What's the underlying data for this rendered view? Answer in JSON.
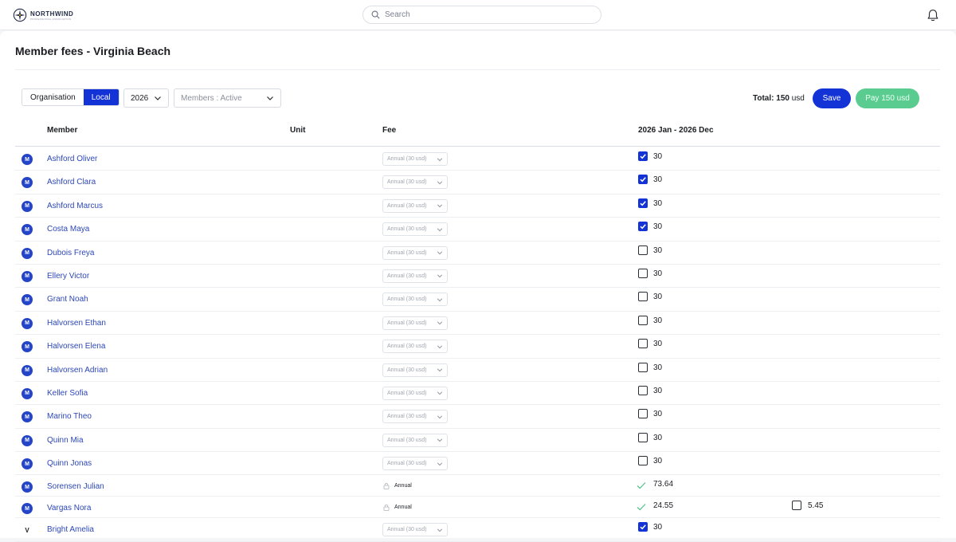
{
  "header": {
    "logo_name": "NORTHWIND",
    "logo_sub": "PROFESSIONAL ASSOCIATION",
    "search_placeholder": "Search"
  },
  "page": {
    "title": "Member fees - Virginia Beach"
  },
  "toolbar": {
    "scope_tabs": [
      "Organisation",
      "Local"
    ],
    "active_scope": "Local",
    "year": "2026",
    "members_filter": "Members : Active",
    "total_label": "Total:",
    "total_value": "150",
    "total_unit": "usd",
    "save_label": "Save",
    "pay_label": "Pay 150 usd"
  },
  "table": {
    "columns": [
      "Member",
      "Unit",
      "Fee",
      "2026 Jan - 2026 Dec"
    ],
    "rows": [
      {
        "avatar": "M",
        "name": "Ashford Oliver",
        "fee": "Annual (30 usd)",
        "fee_type": "select",
        "paid": true,
        "amount": "30"
      },
      {
        "avatar": "M",
        "name": "Ashford Clara",
        "fee": "Annual (30 usd)",
        "fee_type": "select",
        "paid": true,
        "amount": "30"
      },
      {
        "avatar": "M",
        "name": "Ashford Marcus",
        "fee": "Annual (30 usd)",
        "fee_type": "select",
        "paid": true,
        "amount": "30"
      },
      {
        "avatar": "M",
        "name": "Costa Maya",
        "fee": "Annual (30 usd)",
        "fee_type": "select",
        "paid": true,
        "amount": "30"
      },
      {
        "avatar": "M",
        "name": "Dubois Freya",
        "fee": "Annual (30 usd)",
        "fee_type": "select",
        "paid": false,
        "amount": "30"
      },
      {
        "avatar": "M",
        "name": "Ellery Victor",
        "fee": "Annual (30 usd)",
        "fee_type": "select",
        "paid": false,
        "amount": "30"
      },
      {
        "avatar": "M",
        "name": "Grant Noah",
        "fee": "Annual (30 usd)",
        "fee_type": "select",
        "paid": false,
        "amount": "30"
      },
      {
        "avatar": "M",
        "name": "Halvorsen Ethan",
        "fee": "Annual (30 usd)",
        "fee_type": "select",
        "paid": false,
        "amount": "30"
      },
      {
        "avatar": "M",
        "name": "Halvorsen Elena",
        "fee": "Annual (30 usd)",
        "fee_type": "select",
        "paid": false,
        "amount": "30"
      },
      {
        "avatar": "M",
        "name": "Halvorsen Adrian",
        "fee": "Annual (30 usd)",
        "fee_type": "select",
        "paid": false,
        "amount": "30"
      },
      {
        "avatar": "M",
        "name": "Keller Sofia",
        "fee": "Annual (30 usd)",
        "fee_type": "select",
        "paid": false,
        "amount": "30"
      },
      {
        "avatar": "M",
        "name": "Marino Theo",
        "fee": "Annual (30 usd)",
        "fee_type": "select",
        "paid": false,
        "amount": "30"
      },
      {
        "avatar": "M",
        "name": "Quinn Mia",
        "fee": "Annual (30 usd)",
        "fee_type": "select",
        "paid": false,
        "amount": "30"
      },
      {
        "avatar": "M",
        "name": "Quinn Jonas",
        "fee": "Annual (30 usd)",
        "fee_type": "select",
        "paid": false,
        "amount": "30"
      },
      {
        "avatar": "M",
        "name": "Sorensen Julian",
        "fee": "Annual",
        "fee_type": "locked",
        "paid": "done",
        "amount": "73.64"
      },
      {
        "avatar": "M",
        "name": "Vargas Nora",
        "fee": "Annual",
        "fee_type": "locked",
        "paid": "done",
        "amount": "24.55",
        "extra_amount": "5.45"
      },
      {
        "avatar": "V",
        "name": "Bright Amelia",
        "fee": "Annual (30 usd)",
        "fee_type": "select",
        "paid": true,
        "amount": "30"
      }
    ]
  },
  "colors": {
    "primary": "#1433d6",
    "pay_button": "#5bcc90",
    "link": "#2d47b8"
  }
}
